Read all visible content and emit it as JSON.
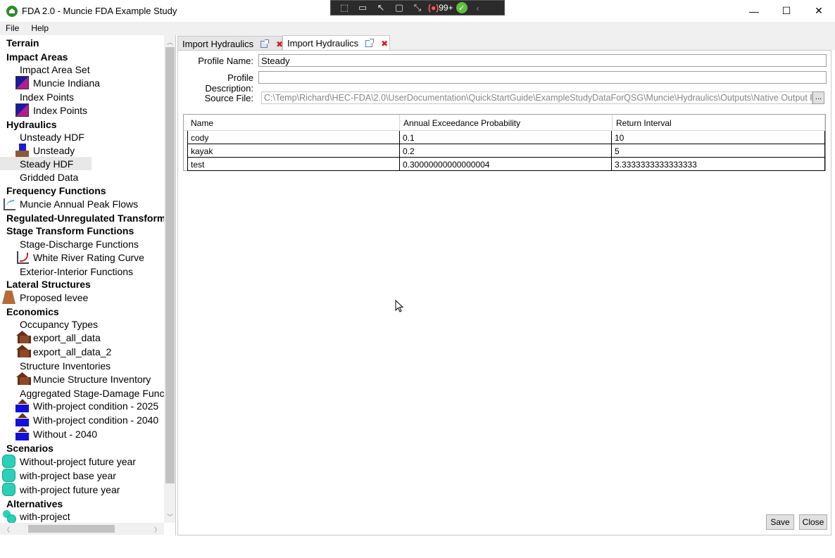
{
  "window": {
    "title": "FDA 2.0 - Muncie FDA Example Study",
    "minimize_glyph": "—",
    "maximize_glyph": "☐",
    "close_glyph": "✕"
  },
  "overlay": {
    "badge_count": "99+"
  },
  "menu": {
    "file": "File",
    "help": "Help"
  },
  "tree": {
    "terrain": "Terrain",
    "impact_areas": "Impact Areas",
    "impact_area_set": "Impact Area Set",
    "muncie_indiana": "Muncie Indiana",
    "index_points_group": "Index Points",
    "index_points_item": "Index Points",
    "hydraulics": "Hydraulics",
    "unsteady_hdf": "Unsteady HDF",
    "unsteady": "Unsteady",
    "steady_hdf": "Steady HDF",
    "gridded_data": "Gridded Data",
    "frequency_functions": "Frequency Functions",
    "muncie_annual_peak_flows": "Muncie Annual Peak Flows",
    "regulated_unregulated": "Regulated-Unregulated Transform",
    "stage_transform": "Stage Transform Functions",
    "stage_discharge": "Stage-Discharge Functions",
    "white_river_rating": "White River Rating Curve",
    "exterior_interior": "Exterior-Interior Functions",
    "lateral_structures": "Lateral Structures",
    "proposed_levee": "Proposed levee",
    "economics": "Economics",
    "occupancy_types": "Occupancy Types",
    "export_all_data": "export_all_data",
    "export_all_data_2": "export_all_data_2",
    "structure_inventories": "Structure Inventories",
    "muncie_structure_inventory": "Muncie Structure Inventory",
    "aggregated_stage_damage": "Aggregated Stage-Damage Funct",
    "with_project_2025": "With-project condition - 2025",
    "with_project_2040": "With-project condition - 2040",
    "without_2040": "Without - 2040",
    "scenarios": "Scenarios",
    "without_project_future": "Without-project future year",
    "with_project_base": "with-project base year",
    "with_project_future": "with-project future year",
    "alternatives": "Alternatives",
    "with_project": "with-project"
  },
  "tabs": [
    {
      "label": "Import Hydraulics"
    },
    {
      "label": "Import Hydraulics"
    }
  ],
  "form": {
    "profile_name_label": "Profile Name:",
    "profile_name_value": "Steady",
    "profile_desc_label": "Profile Description:",
    "profile_desc_value": "",
    "source_file_label": "Source File:",
    "source_file_value": "C:\\Temp\\Richard\\HEC-FDA\\2.0\\UserDocumentation\\QuickStartGuide\\ExampleStudyDataForQSG\\Muncie\\Hydraulics\\Outputs\\Native Output Files\\M",
    "browse_label": "..."
  },
  "grid": {
    "headers": [
      "Name",
      "Annual Exceedance Probability",
      "Return Interval"
    ],
    "rows": [
      [
        "cody",
        "0.1",
        "10"
      ],
      [
        "kayak",
        "0.2",
        "5"
      ],
      [
        "test",
        "0.30000000000000004",
        "3.3333333333333333"
      ]
    ]
  },
  "buttons": {
    "save": "Save",
    "close": "Close"
  },
  "colors": {
    "close_x": "#d02020",
    "scenario": "#2ad0b8",
    "app_icon": "#2e8b2e"
  }
}
